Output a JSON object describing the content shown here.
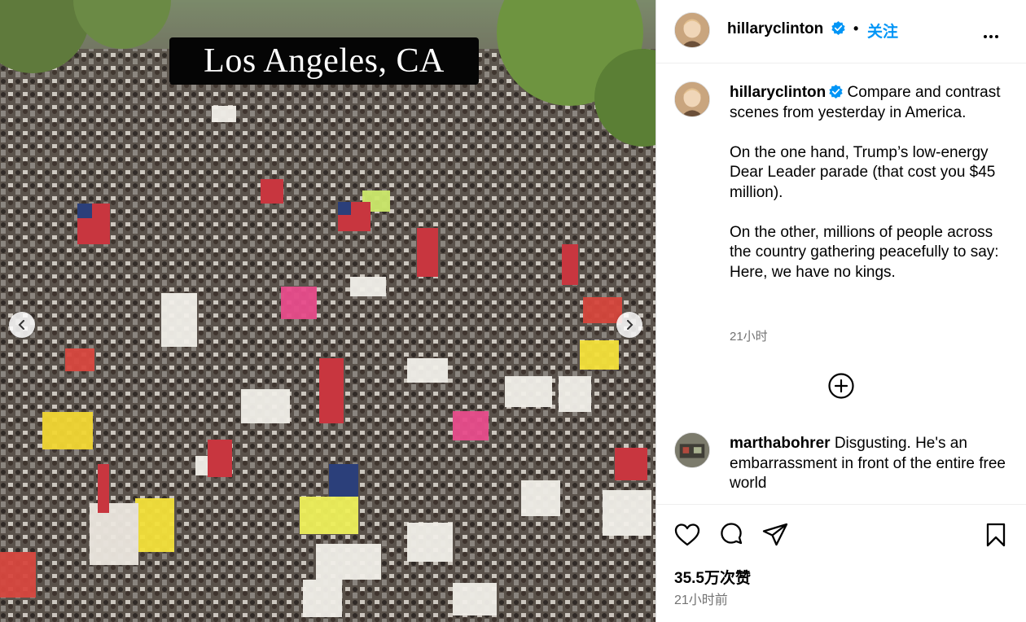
{
  "media": {
    "overlay_caption": "Los Angeles, CA",
    "prev_icon": "chevron-left-icon",
    "next_icon": "chevron-right-icon"
  },
  "header": {
    "username": "hillaryclinton",
    "separator": "•",
    "follow_label": "关注",
    "more_icon": "more-options-icon"
  },
  "caption": {
    "username": "hillaryclinton",
    "paragraphs": [
      "Compare and contrast scenes from yesterday in America.",
      "On the one hand, Trump’s low-energy Dear Leader parade (that cost you $45 million).",
      "On the other, millions of people across the country gathering peacefully to say: Here, we have no kings."
    ],
    "time": "21小时"
  },
  "load_more_icon": "plus-circle-icon",
  "comments": [
    {
      "username": "marthabohrer",
      "text": "Disgusting. He's an embarrassment in front of the entire free world"
    }
  ],
  "actions": {
    "like_icon": "heart-icon",
    "comment_icon": "comment-icon",
    "share_icon": "send-icon",
    "save_icon": "bookmark-icon",
    "likes": "35.5万次赞",
    "posted_time": "21小时前"
  },
  "colors": {
    "accent": "#0095f6",
    "verified": "#0095f6",
    "secondary_text": "#737373"
  }
}
